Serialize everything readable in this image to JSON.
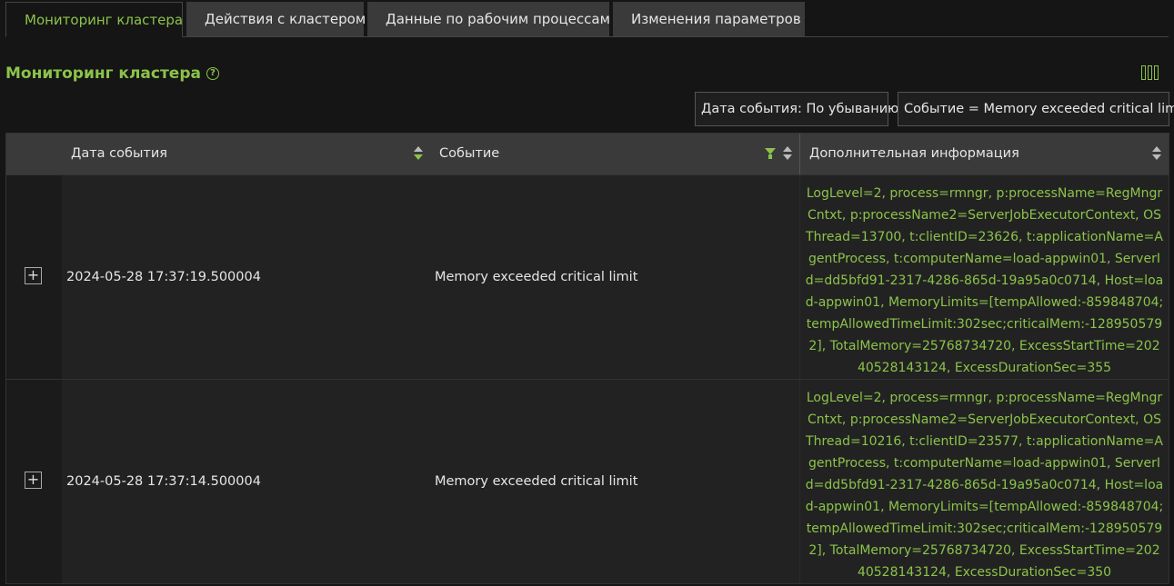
{
  "tabs": [
    {
      "label": "Мониторинг кластера",
      "active": true
    },
    {
      "label": "Действия с кластером",
      "active": false
    },
    {
      "label": "Данные по рабочим процессам",
      "active": false
    },
    {
      "label": "Изменения параметров",
      "active": false
    }
  ],
  "page": {
    "title": "Мониторинг кластера",
    "help_icon": "question-circle-icon",
    "columns_icon": "columns-icon"
  },
  "filters": {
    "sort_chip": "Дата события: По убыванию",
    "event_chip": "Событие = Memory exceeded critical limit"
  },
  "table": {
    "headers": {
      "date": "Дата события",
      "event": "Событие",
      "info": "Дополнительная информация"
    },
    "rows": [
      {
        "date": "2024-05-28 17:37:19.500004",
        "event": "Memory exceeded critical limit",
        "info": "LogLevel=2, process=rmngr, p:processName=RegMngrCntxt, p:processName2=ServerJobExecutorContext, OSThread=13700, t:clientID=23626, t:applicationName=AgentProcess, t:computerName=load-appwin01, ServerId=dd5bfd91-2317-4286-865d-19a95a0c0714, Host=load-appwin01, MemoryLimits=[tempAllowed:-859848704;tempAllowedTimeLimit:302sec;criticalMem:-1289505792], TotalMemory=25768734720, ExcessStartTime=20240528143124, ExcessDurationSec=355"
      },
      {
        "date": "2024-05-28 17:37:14.500004",
        "event": "Memory exceeded critical limit",
        "info": "LogLevel=2, process=rmngr, p:processName=RegMngrCntxt, p:processName2=ServerJobExecutorContext, OSThread=10216, t:clientID=23577, t:applicationName=AgentProcess, t:computerName=load-appwin01, ServerId=dd5bfd91-2317-4286-865d-19a95a0c0714, Host=load-appwin01, MemoryLimits=[tempAllowed:-859848704;tempAllowedTimeLimit:302sec;criticalMem:-1289505792], TotalMemory=25768734720, ExcessStartTime=20240528143124, ExcessDurationSec=350"
      }
    ]
  },
  "colors": {
    "accent": "#8bc34a",
    "background": "#151515",
    "header_bg": "#3a3a3a"
  }
}
